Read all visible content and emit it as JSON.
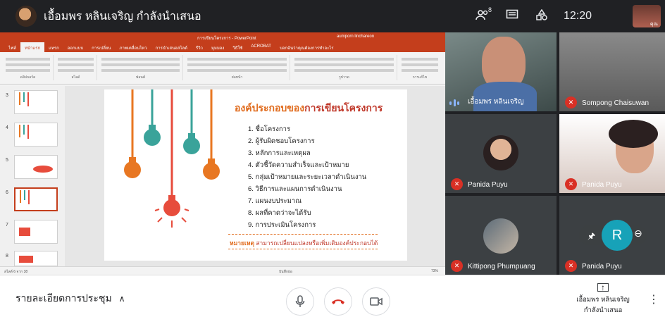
{
  "topbar": {
    "presenter_title": "เอื้อมพร หลินเจริญ กำลังนำเสนอ",
    "participants_count": "8",
    "clock": "12:20",
    "self_label": "คุณ"
  },
  "powerpoint": {
    "window_title": "การเขียนโครงการ - PowerPoint",
    "user": "aumporn linchareon",
    "tabs": [
      "ไฟล์",
      "หน้าแรก",
      "แทรก",
      "ออกแบบ",
      "การเปลี่ยน",
      "ภาพเคลื่อนไหว",
      "การนำเสนอสไลด์",
      "รีวิว",
      "มุมมอง",
      "วิธีใช้",
      "ACROBAT",
      "บอกฉันว่าคุณต้องการทำอะไร"
    ],
    "ribbon_groups": [
      "คลิปบอร์ด",
      "สไลด์",
      "ฟอนต์",
      "ย่อหน้า",
      "รูปวาด",
      "การแก้ไข"
    ],
    "thumb_numbers": [
      "3",
      "4",
      "5",
      "6",
      "7",
      "8"
    ],
    "status_left": "สไลด์ 6 จาก 38",
    "status_notes": "บันทึกย่อ",
    "status_zoom": "73%"
  },
  "slide": {
    "title_part1": "องค์ประกอบของ",
    "title_part2": "การเขียนโครงการ",
    "items": [
      "1. ชื่อโครงการ",
      "2. ผู้รับผิดชอบโครงการ",
      "3. หลักการและเหตุผล",
      "4. ตัวชี้วัดความสำเร็จและเป้าหมาย",
      "5. กลุ่มเป้าหมายและระยะเวลาดำเนินงาน",
      "6. วิธีการและแผนการดำเนินงาน",
      "7. แผนงบประมาณ",
      "8. ผลที่คาดว่าจะได้รับ",
      "9. การประเมินโครงการ"
    ],
    "note_label": "หมายเหตุ",
    "note_text": " สามารถเปลี่ยนแปลงหรือเพิ่มเติมองค์ประกอบได้"
  },
  "participants": [
    {
      "name": "เอื้อมพร หลินเจริญ",
      "state": "speaking"
    },
    {
      "name": "Sompong Chaisuwan",
      "state": "muted"
    },
    {
      "name": "Panida Puyu",
      "state": "muted"
    },
    {
      "name": "Panida Puyu",
      "state": "muted"
    },
    {
      "name": "Kittipong Phumpuang",
      "state": "muted"
    },
    {
      "name": "Panida Puyu",
      "state": "muted"
    }
  ],
  "tile_overlay": {
    "pin_icon": "pin-icon",
    "avatar_letter": "R",
    "remove_icon": "minus-circle-icon"
  },
  "bottombar": {
    "details_label": "รายละเอียดการประชุม",
    "presenting_line1": "เอื้อมพร หลินเจริญ",
    "presenting_line2": "กำลังนำเสนอ"
  },
  "colors": {
    "ppt_accent": "#c43e1c",
    "slide_orange": "#e06a1b",
    "mute_red": "#d93025",
    "hangup_red": "#d93025",
    "dark_bg": "#202124"
  }
}
